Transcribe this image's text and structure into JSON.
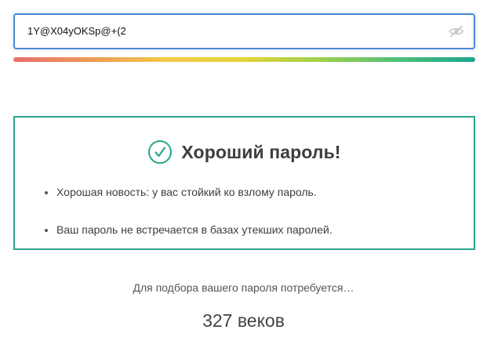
{
  "password_field": {
    "value": "1Y@X04yOKSp@+(2",
    "visibility_icon": "eye-slash-icon"
  },
  "strength_meter": {
    "level": 1.0,
    "gradient_colors": [
      "#ec6f6f",
      "#f09a55",
      "#f4c94a",
      "#e2d43b",
      "#9ed04b",
      "#4fbf7a",
      "#1aa68c"
    ]
  },
  "result": {
    "icon": "check-circle-icon",
    "title": "Хороший пароль!",
    "border_color": "#29a58e",
    "items": [
      "Хорошая новость: у вас стойкий ко взлому пароль.",
      "Ваш пароль не встречается в базах утекших паролей."
    ]
  },
  "crack_time": {
    "label": "Для подбора вашего пароля потребуется…",
    "value": "327 веков"
  }
}
